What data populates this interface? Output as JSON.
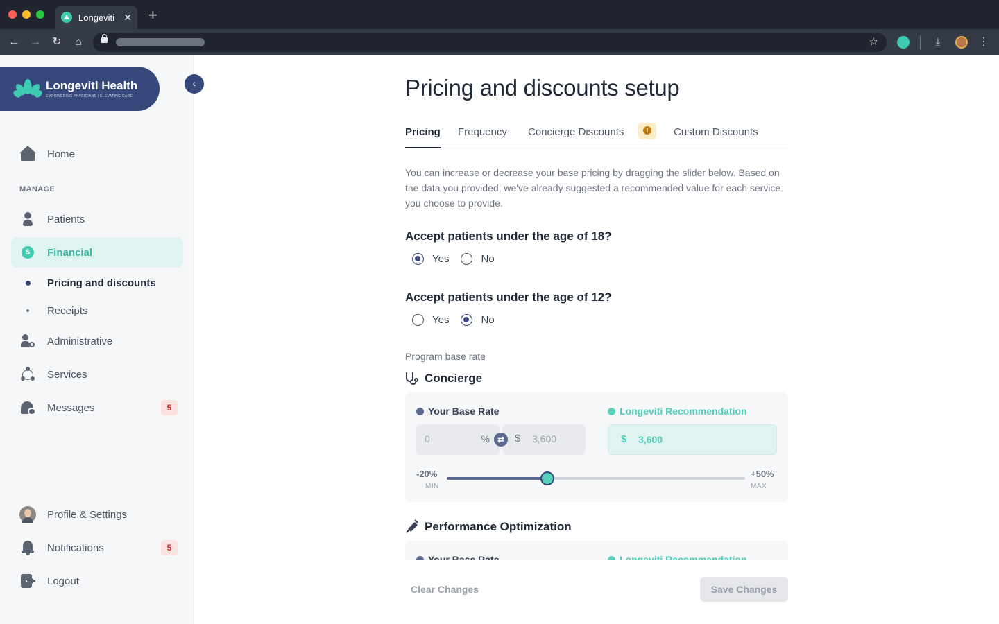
{
  "browser": {
    "tab_title": "Longeviti",
    "new_tab": "+",
    "close": "✕"
  },
  "brand": {
    "name": "Longeviti Health",
    "tagline": "EMPOWERING PHYSICIANS | ELEVATING CARE",
    "color": "#36477a",
    "accent": "#3ecbb1"
  },
  "sidebar": {
    "home": "Home",
    "section_label": "MANAGE",
    "items": [
      {
        "label": "Patients",
        "icon": "person-icon"
      },
      {
        "label": "Financial",
        "icon": "dollar-icon",
        "active": true
      },
      {
        "label": "Pricing and discounts",
        "sub": true,
        "current": true
      },
      {
        "label": "Receipts",
        "sub": true
      },
      {
        "label": "Administrative",
        "icon": "admin-icon"
      },
      {
        "label": "Services",
        "icon": "services-icon"
      },
      {
        "label": "Messages",
        "icon": "messages-icon",
        "badge": "5"
      }
    ],
    "footer": [
      {
        "label": "Profile & Settings",
        "icon": "avatar"
      },
      {
        "label": "Notifications",
        "icon": "bell-icon",
        "badge": "5"
      },
      {
        "label": "Logout",
        "icon": "logout-icon"
      }
    ]
  },
  "page": {
    "title": "Pricing and discounts setup",
    "tabs": [
      "Pricing",
      "Frequency",
      "Concierge Discounts",
      "Custom Discounts"
    ],
    "active_tab": "Pricing",
    "description": "You can increase or decrease your base pricing by dragging the slider below. Based on the data you provided, we've already suggested a recommended value for each service you choose to provide.",
    "q1": {
      "question": "Accept patients under the age of 18?",
      "yes": "Yes",
      "no": "No",
      "selected": "Yes"
    },
    "q2": {
      "question": "Accept patients under the age of 12?",
      "yes": "Yes",
      "no": "No",
      "selected": "No"
    },
    "program_label": "Program base rate",
    "services": [
      {
        "name": "Concierge",
        "icon": "stethoscope-icon",
        "your_rate_label": "Your Base Rate",
        "rec_label": "Longeviti Recommendation",
        "percent_value": "0",
        "percent_sign": "%",
        "currency": "$",
        "base_value": "3,600",
        "rec_value": "3,600",
        "min_label": "-20%",
        "min_sub": "MIN",
        "max_label": "+50%",
        "max_sub": "MAX",
        "slider_fraction": 0.338
      },
      {
        "name": "Performance Optimization",
        "icon": "syringe-icon",
        "your_rate_label": "Your Base Rate",
        "rec_label": "Longeviti Recommendation"
      }
    ],
    "clear_label": "Clear Changes",
    "save_label": "Save Changes"
  }
}
